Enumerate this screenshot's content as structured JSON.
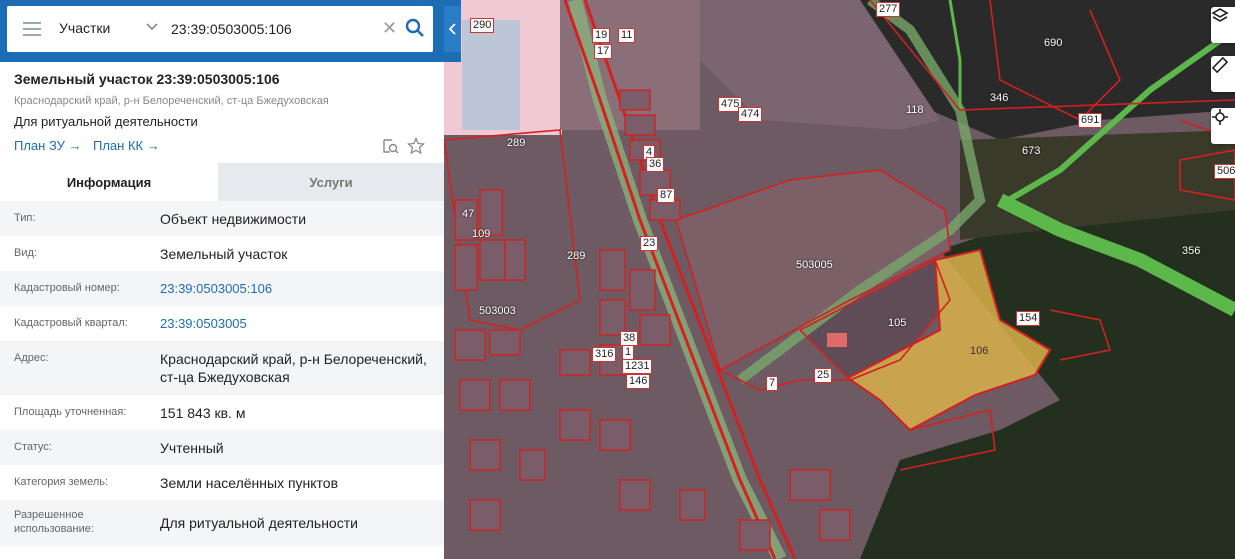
{
  "search": {
    "type_value": "Участки",
    "query": "23:39:0503005:106"
  },
  "panel": {
    "title": "Земельный участок 23:39:0503005:106",
    "address_sub": "Краснодарский край, р-н Белореченский, ст-ца Бжедуховская",
    "purpose": "Для ритуальной деятельности",
    "plan_zu": "План ЗУ →",
    "plan_kk": "План КК →",
    "tabs": [
      "Информация",
      "Услуги"
    ],
    "rows": [
      {
        "label": "Тип:",
        "value": "Объект недвижимости"
      },
      {
        "label": "Вид:",
        "value": "Земельный участок"
      },
      {
        "label": "Кадастровый номер:",
        "value": "23:39:0503005:106"
      },
      {
        "label": "Кадастровый квартал:",
        "value": "23:39:0503005"
      },
      {
        "label": "Адрес:",
        "value": "Краснодарский край, р-н Белореченский, ст-ца Бжедуховская"
      },
      {
        "label": "Площадь уточненная:",
        "value": "151 843 кв. м"
      },
      {
        "label": "Статус:",
        "value": "Учтенный"
      },
      {
        "label": "Категория земель:",
        "value": "Земли населённых пунктов"
      },
      {
        "label": "Разрешенное использование:",
        "value": "Для ритуальной деятельности"
      }
    ]
  },
  "map": {
    "labels": [
      "290",
      "19",
      "17",
      "11",
      "277",
      "690",
      "346",
      "691",
      "118",
      "289",
      "475",
      "474",
      "673",
      "506",
      "4",
      "36",
      "87",
      "23",
      "503005",
      "105",
      "154",
      "106",
      "356",
      "289",
      "47",
      "109",
      "503003",
      "38",
      "1",
      "316",
      "1231",
      "146",
      "7",
      "25"
    ]
  },
  "icons": {
    "layers": "layers-icon",
    "ruler": "ruler-icon",
    "locate": "locate-icon"
  },
  "colors": {
    "brand": "#1d6db5",
    "parcel_border": "#d42020",
    "selected_fill": "#d9b04a",
    "green_zone": "#5cb84a"
  }
}
